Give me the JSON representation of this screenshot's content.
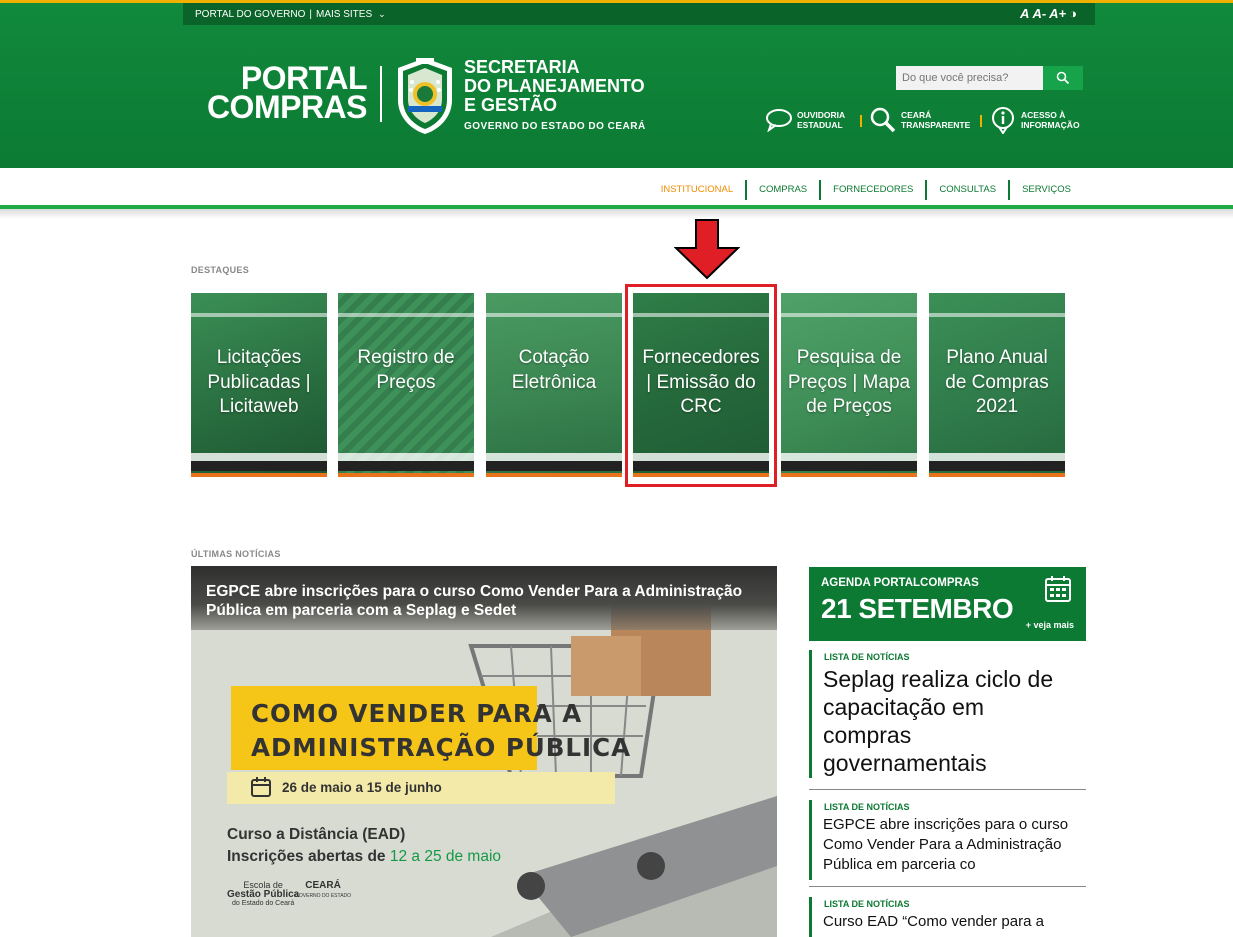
{
  "gov_bar": {
    "portal_governo": "PORTAL DO GOVERNO",
    "separator": "|",
    "mais_sites": "MAIS SITES",
    "chevron": "⌄"
  },
  "font_controls": [
    "A",
    "A-",
    "A+",
    "◑"
  ],
  "logo": {
    "portal": "PORTAL",
    "compras": "COMPRAS",
    "secretaria_line1": "SECRETARIA",
    "secretaria_line2": "DO PLANEJAMENTO",
    "secretaria_line3": "E GESTÃO",
    "governo": "GOVERNO DO ESTADO DO CEARÁ"
  },
  "search": {
    "placeholder": "Do que você precisa?"
  },
  "quick_links": [
    {
      "line1": "OUVIDORIA",
      "line2": "ESTADUAL",
      "icon": "speech-bubble-icon"
    },
    {
      "line1": "CEARÁ",
      "line2": "TRANSPARENTE",
      "icon": "magnifier-icon"
    },
    {
      "line1": "ACESSO À",
      "line2": "INFORMAÇÃO",
      "icon": "info-icon"
    }
  ],
  "nav": {
    "items": [
      "INSTITUCIONAL",
      "COMPRAS",
      "FORNECEDORES",
      "CONSULTAS",
      "SERVIÇOS"
    ],
    "active": "INSTITUCIONAL",
    "active_color": "#f08c00",
    "color": "#0c7a33"
  },
  "destaques": {
    "label": "DESTAQUES",
    "tiles": [
      {
        "title": "Licitações Publicadas | Licitaweb"
      },
      {
        "title": "Registro de Preços"
      },
      {
        "title": "Cotação Eletrônica"
      },
      {
        "title": "Fornecedores | Emissão do CRC"
      },
      {
        "title": "Pesquisa de Preços | Mapa de Preços"
      },
      {
        "title": "Plano Anual de Compras 2021"
      }
    ]
  },
  "noticias": {
    "label": "ÚLTIMAS NOTÍCIAS",
    "main": {
      "title": "EGPCE abre inscrições para o curso Como Vender Para a Administração Pública em parceria com a Seplag e Sedet",
      "banner_line1": "COMO VENDER PARA A",
      "banner_line2": "ADMINISTRAÇÃO PÚBLICA",
      "dates": "26 de maio a 15 de junho",
      "course_line1": "Curso a Distância (EAD)",
      "course_line2": "Inscrições abertas de",
      "course_dates": "12 a 25 de maio",
      "logo1_line1": "Escola de",
      "logo1_line2": "Gestão Pública",
      "logo1_line3": "do Estado do Ceará",
      "logo2": "CEARÁ",
      "logo2_sub": "GOVERNO DO ESTADO"
    }
  },
  "agenda": {
    "label": "AGENDA PORTALCOMPRAS",
    "date": "21 SETEMBRO",
    "more": "+ veja mais"
  },
  "side_news": [
    {
      "category": "LISTA DE NOTÍCIAS",
      "title": "Seplag realiza ciclo de capacitação em compras governamentais"
    },
    {
      "category": "LISTA DE NOTÍCIAS",
      "title": "EGPCE abre inscrições para o curso Como Vender Para a Administração Pública em parceria co"
    },
    {
      "category": "LISTA DE NOTÍCIAS",
      "title": "Curso EAD “Como vender para a"
    }
  ]
}
